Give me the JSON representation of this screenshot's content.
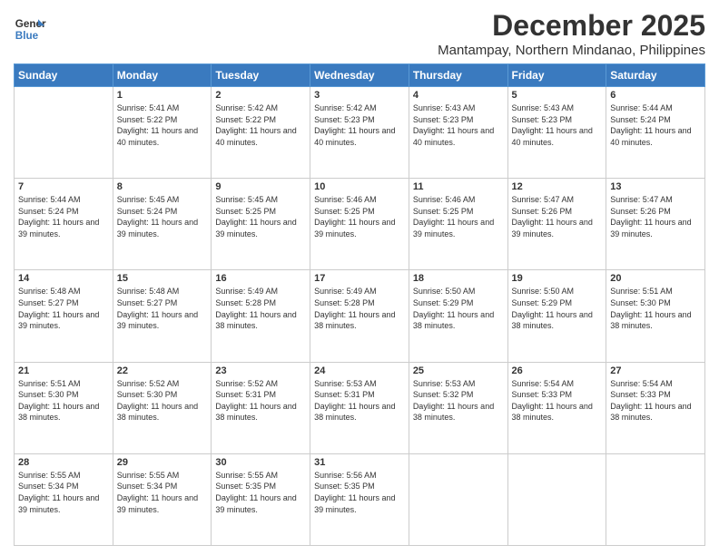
{
  "logo": {
    "line1": "General",
    "line2": "Blue"
  },
  "title": "December 2025",
  "subtitle": "Mantampay, Northern Mindanao, Philippines",
  "weekdays": [
    "Sunday",
    "Monday",
    "Tuesday",
    "Wednesday",
    "Thursday",
    "Friday",
    "Saturday"
  ],
  "weeks": [
    [
      {
        "day": null
      },
      {
        "day": 1,
        "sunrise": "5:41 AM",
        "sunset": "5:22 PM",
        "daylight": "11 hours and 40 minutes."
      },
      {
        "day": 2,
        "sunrise": "5:42 AM",
        "sunset": "5:22 PM",
        "daylight": "11 hours and 40 minutes."
      },
      {
        "day": 3,
        "sunrise": "5:42 AM",
        "sunset": "5:23 PM",
        "daylight": "11 hours and 40 minutes."
      },
      {
        "day": 4,
        "sunrise": "5:43 AM",
        "sunset": "5:23 PM",
        "daylight": "11 hours and 40 minutes."
      },
      {
        "day": 5,
        "sunrise": "5:43 AM",
        "sunset": "5:23 PM",
        "daylight": "11 hours and 40 minutes."
      },
      {
        "day": 6,
        "sunrise": "5:44 AM",
        "sunset": "5:24 PM",
        "daylight": "11 hours and 40 minutes."
      }
    ],
    [
      {
        "day": 7,
        "sunrise": "5:44 AM",
        "sunset": "5:24 PM",
        "daylight": "11 hours and 39 minutes."
      },
      {
        "day": 8,
        "sunrise": "5:45 AM",
        "sunset": "5:24 PM",
        "daylight": "11 hours and 39 minutes."
      },
      {
        "day": 9,
        "sunrise": "5:45 AM",
        "sunset": "5:25 PM",
        "daylight": "11 hours and 39 minutes."
      },
      {
        "day": 10,
        "sunrise": "5:46 AM",
        "sunset": "5:25 PM",
        "daylight": "11 hours and 39 minutes."
      },
      {
        "day": 11,
        "sunrise": "5:46 AM",
        "sunset": "5:25 PM",
        "daylight": "11 hours and 39 minutes."
      },
      {
        "day": 12,
        "sunrise": "5:47 AM",
        "sunset": "5:26 PM",
        "daylight": "11 hours and 39 minutes."
      },
      {
        "day": 13,
        "sunrise": "5:47 AM",
        "sunset": "5:26 PM",
        "daylight": "11 hours and 39 minutes."
      }
    ],
    [
      {
        "day": 14,
        "sunrise": "5:48 AM",
        "sunset": "5:27 PM",
        "daylight": "11 hours and 39 minutes."
      },
      {
        "day": 15,
        "sunrise": "5:48 AM",
        "sunset": "5:27 PM",
        "daylight": "11 hours and 39 minutes."
      },
      {
        "day": 16,
        "sunrise": "5:49 AM",
        "sunset": "5:28 PM",
        "daylight": "11 hours and 38 minutes."
      },
      {
        "day": 17,
        "sunrise": "5:49 AM",
        "sunset": "5:28 PM",
        "daylight": "11 hours and 38 minutes."
      },
      {
        "day": 18,
        "sunrise": "5:50 AM",
        "sunset": "5:29 PM",
        "daylight": "11 hours and 38 minutes."
      },
      {
        "day": 19,
        "sunrise": "5:50 AM",
        "sunset": "5:29 PM",
        "daylight": "11 hours and 38 minutes."
      },
      {
        "day": 20,
        "sunrise": "5:51 AM",
        "sunset": "5:30 PM",
        "daylight": "11 hours and 38 minutes."
      }
    ],
    [
      {
        "day": 21,
        "sunrise": "5:51 AM",
        "sunset": "5:30 PM",
        "daylight": "11 hours and 38 minutes."
      },
      {
        "day": 22,
        "sunrise": "5:52 AM",
        "sunset": "5:30 PM",
        "daylight": "11 hours and 38 minutes."
      },
      {
        "day": 23,
        "sunrise": "5:52 AM",
        "sunset": "5:31 PM",
        "daylight": "11 hours and 38 minutes."
      },
      {
        "day": 24,
        "sunrise": "5:53 AM",
        "sunset": "5:31 PM",
        "daylight": "11 hours and 38 minutes."
      },
      {
        "day": 25,
        "sunrise": "5:53 AM",
        "sunset": "5:32 PM",
        "daylight": "11 hours and 38 minutes."
      },
      {
        "day": 26,
        "sunrise": "5:54 AM",
        "sunset": "5:33 PM",
        "daylight": "11 hours and 38 minutes."
      },
      {
        "day": 27,
        "sunrise": "5:54 AM",
        "sunset": "5:33 PM",
        "daylight": "11 hours and 38 minutes."
      }
    ],
    [
      {
        "day": 28,
        "sunrise": "5:55 AM",
        "sunset": "5:34 PM",
        "daylight": "11 hours and 39 minutes."
      },
      {
        "day": 29,
        "sunrise": "5:55 AM",
        "sunset": "5:34 PM",
        "daylight": "11 hours and 39 minutes."
      },
      {
        "day": 30,
        "sunrise": "5:55 AM",
        "sunset": "5:35 PM",
        "daylight": "11 hours and 39 minutes."
      },
      {
        "day": 31,
        "sunrise": "5:56 AM",
        "sunset": "5:35 PM",
        "daylight": "11 hours and 39 minutes."
      },
      {
        "day": null
      },
      {
        "day": null
      },
      {
        "day": null
      }
    ]
  ]
}
